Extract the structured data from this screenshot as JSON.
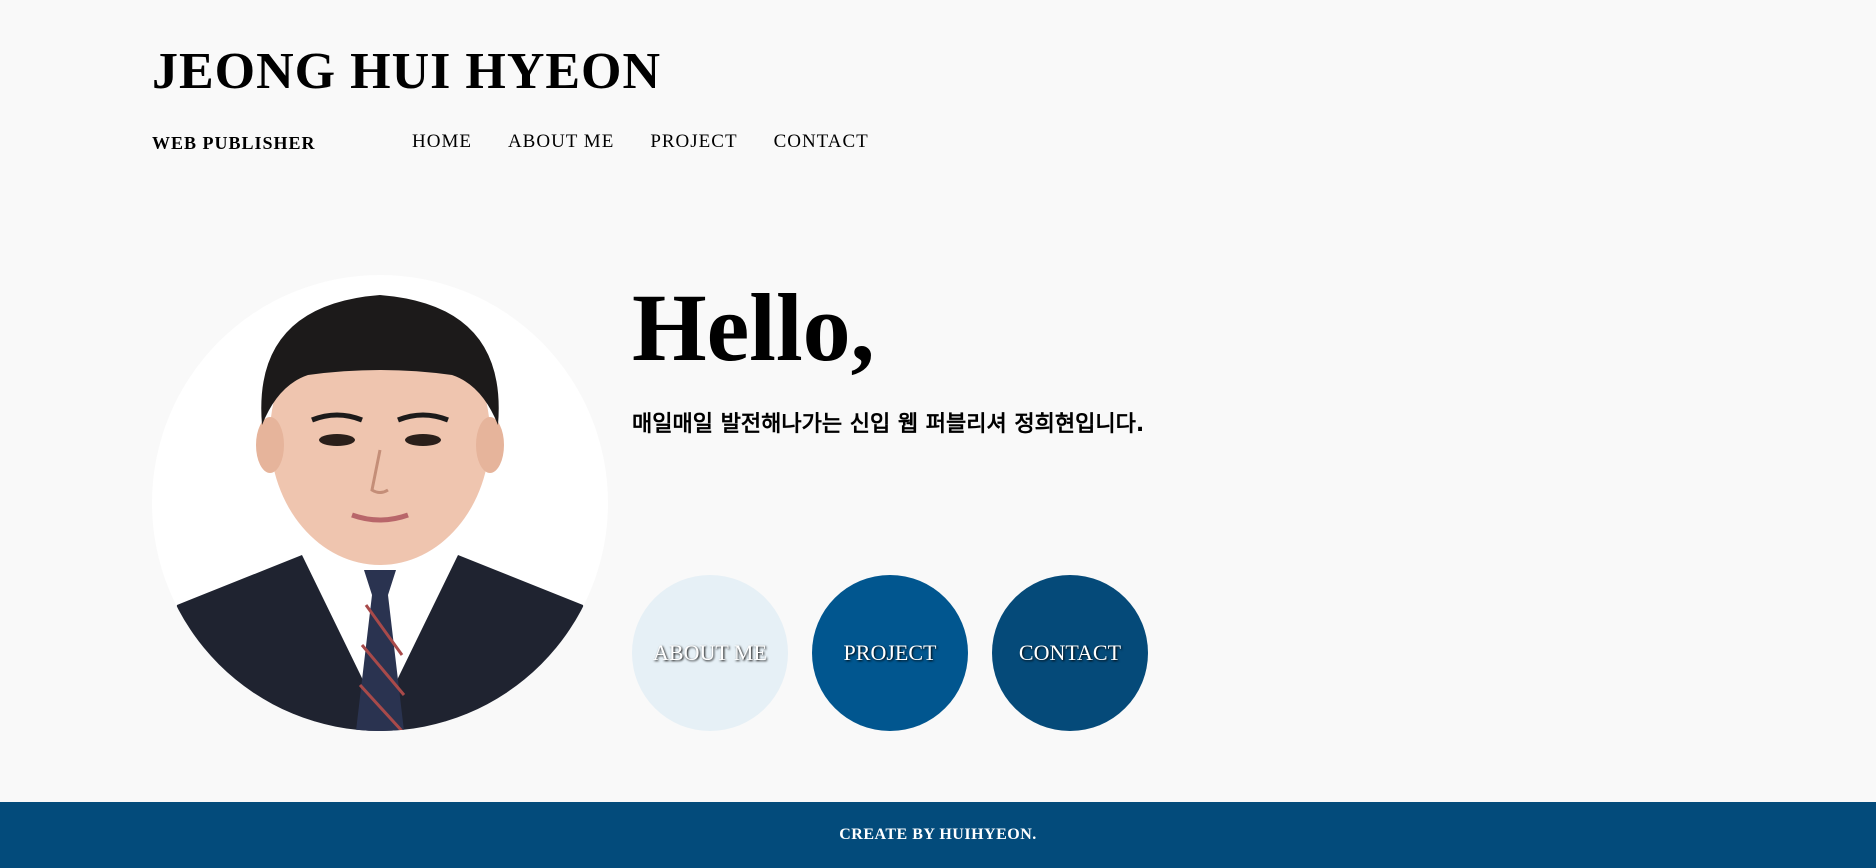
{
  "header": {
    "title": "JEONG HUI HYEON",
    "subtitle": "WEB PUBLISHER",
    "nav": [
      "HOME",
      "ABOUT ME",
      "PROJECT",
      "CONTACT"
    ]
  },
  "hero": {
    "greeting": "Hello,",
    "intro": "매일매일 발전해나가는 신입 웹 퍼블리셔 정희현입니다."
  },
  "buttons": [
    "ABOUT ME",
    "PROJECT",
    "CONTACT"
  ],
  "footer": {
    "text": "CREATE BY HUIHYEON."
  },
  "colors": {
    "background": "#f9f9f9",
    "about_button": "#e6f0f6",
    "project_button": "#01568f",
    "contact_button": "#054a79",
    "footer": "#034b7b"
  }
}
